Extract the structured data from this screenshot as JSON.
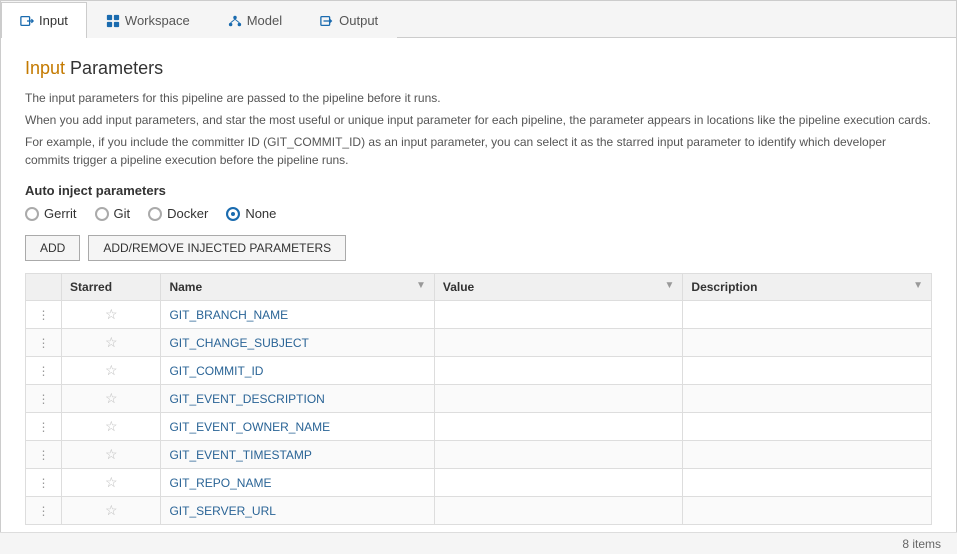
{
  "tabs": [
    {
      "id": "input",
      "label": "Input",
      "active": true,
      "icon": "input-icon"
    },
    {
      "id": "workspace",
      "label": "Workspace",
      "active": false,
      "icon": "workspace-icon"
    },
    {
      "id": "model",
      "label": "Model",
      "active": false,
      "icon": "model-icon"
    },
    {
      "id": "output",
      "label": "Output",
      "active": false,
      "icon": "output-icon"
    }
  ],
  "page": {
    "title_prefix": "Input",
    "title_suffix": " Parameters",
    "desc1": "The input parameters for this pipeline are passed to the pipeline before it runs.",
    "desc2": "When you add input parameters, and star the most useful or unique input parameter for each pipeline, the parameter appears in locations like the pipeline execution cards.",
    "desc3": "For example, if you include the committer ID (GIT_COMMIT_ID) as an input parameter, you can select it as the starred input parameter to identify which developer commits trigger a pipeline execution before the pipeline runs."
  },
  "auto_inject": {
    "label": "Auto inject parameters",
    "options": [
      {
        "id": "gerrit",
        "label": "Gerrit",
        "selected": false
      },
      {
        "id": "git",
        "label": "Git",
        "selected": false
      },
      {
        "id": "docker",
        "label": "Docker",
        "selected": false
      },
      {
        "id": "none",
        "label": "None",
        "selected": true
      }
    ]
  },
  "buttons": {
    "add": "ADD",
    "add_remove": "ADD/REMOVE INJECTED PARAMETERS"
  },
  "table": {
    "columns": [
      {
        "id": "drag",
        "label": ""
      },
      {
        "id": "starred",
        "label": "Starred",
        "sortable": false
      },
      {
        "id": "name",
        "label": "Name",
        "sortable": true
      },
      {
        "id": "value",
        "label": "Value",
        "sortable": true
      },
      {
        "id": "description",
        "label": "Description",
        "sortable": true
      }
    ],
    "rows": [
      {
        "name": "GIT_BRANCH_NAME",
        "value": "",
        "description": ""
      },
      {
        "name": "GIT_CHANGE_SUBJECT",
        "value": "",
        "description": ""
      },
      {
        "name": "GIT_COMMIT_ID",
        "value": "",
        "description": ""
      },
      {
        "name": "GIT_EVENT_DESCRIPTION",
        "value": "",
        "description": ""
      },
      {
        "name": "GIT_EVENT_OWNER_NAME",
        "value": "",
        "description": ""
      },
      {
        "name": "GIT_EVENT_TIMESTAMP",
        "value": "",
        "description": ""
      },
      {
        "name": "GIT_REPO_NAME",
        "value": "",
        "description": ""
      },
      {
        "name": "GIT_SERVER_URL",
        "value": "",
        "description": ""
      }
    ]
  },
  "status_bar": {
    "items_count": "8 items"
  }
}
